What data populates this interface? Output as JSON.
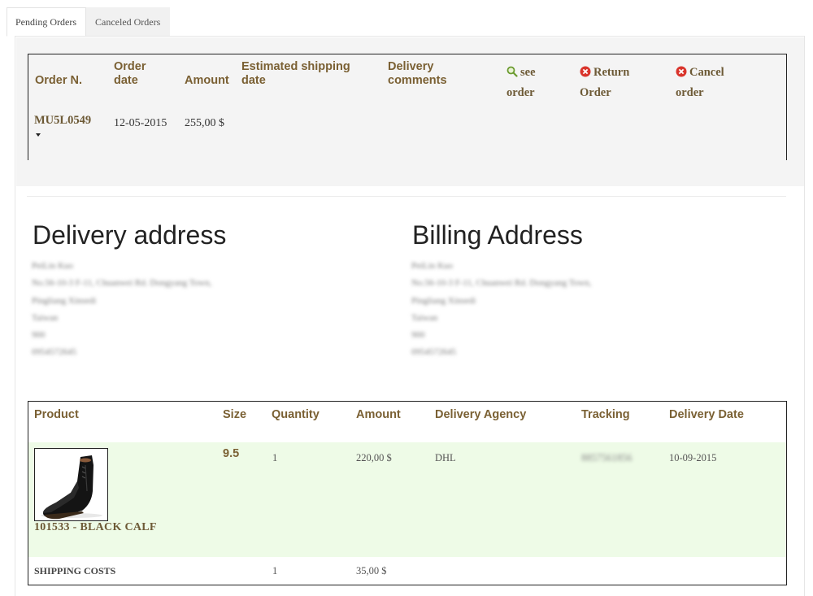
{
  "tabs": [
    {
      "label": "Pending Orders",
      "active": true
    },
    {
      "label": "Canceled Orders",
      "active": false
    }
  ],
  "order_table": {
    "headers": {
      "order_no": "Order N.",
      "order_date_1": "Order",
      "order_date_2": "date",
      "amount": "Amount",
      "est_ship_1": "Estimated shipping",
      "est_ship_2": "date",
      "delivery_1": "Delivery",
      "delivery_2": "comments"
    },
    "actions": {
      "see_1": "see",
      "see_2": "order",
      "return_1": "Return",
      "return_2": "Order",
      "cancel_1": "Cancel",
      "cancel_2": "order"
    },
    "row": {
      "order_no": "MU5L0549",
      "order_date": "12-05-2015",
      "amount": "255,00 $"
    }
  },
  "delivery_address": {
    "title": "Delivery address",
    "lines": [
      "PeiLin Kuo",
      "No.56-10-3 F-11, Chuanwei Rd. Dongyang Town,",
      "Pingliang Xinsedi",
      "Taiwan",
      "900",
      "0954572645"
    ]
  },
  "billing_address": {
    "title": "Billing Address",
    "lines": [
      "PeiLin Kuo",
      "No.56-10-3 F-11, Chuanwei Rd. Dongyang Town,",
      "Pingliang Xinsedi",
      "Taiwan",
      "900",
      "0954572645"
    ]
  },
  "products_table": {
    "headers": {
      "product": "Product",
      "size": "Size",
      "quantity": "Quantity",
      "amount": "Amount",
      "agency": "Delivery Agency",
      "tracking": "Tracking",
      "date": "Delivery Date"
    },
    "item": {
      "name": "101533 - BLACK CALF",
      "size": "9.5",
      "quantity": "1",
      "amount": "220,00 $",
      "agency": "DHL",
      "tracking": "8857561856",
      "date": "10-09-2015"
    },
    "shipping": {
      "label": "SHIPPING COSTS",
      "quantity": "1",
      "amount": "35,00 $"
    }
  },
  "icons": {
    "see": "magnifier-icon",
    "return": "red-x-icon",
    "cancel": "red-x-icon",
    "product": "black-boot-image"
  }
}
